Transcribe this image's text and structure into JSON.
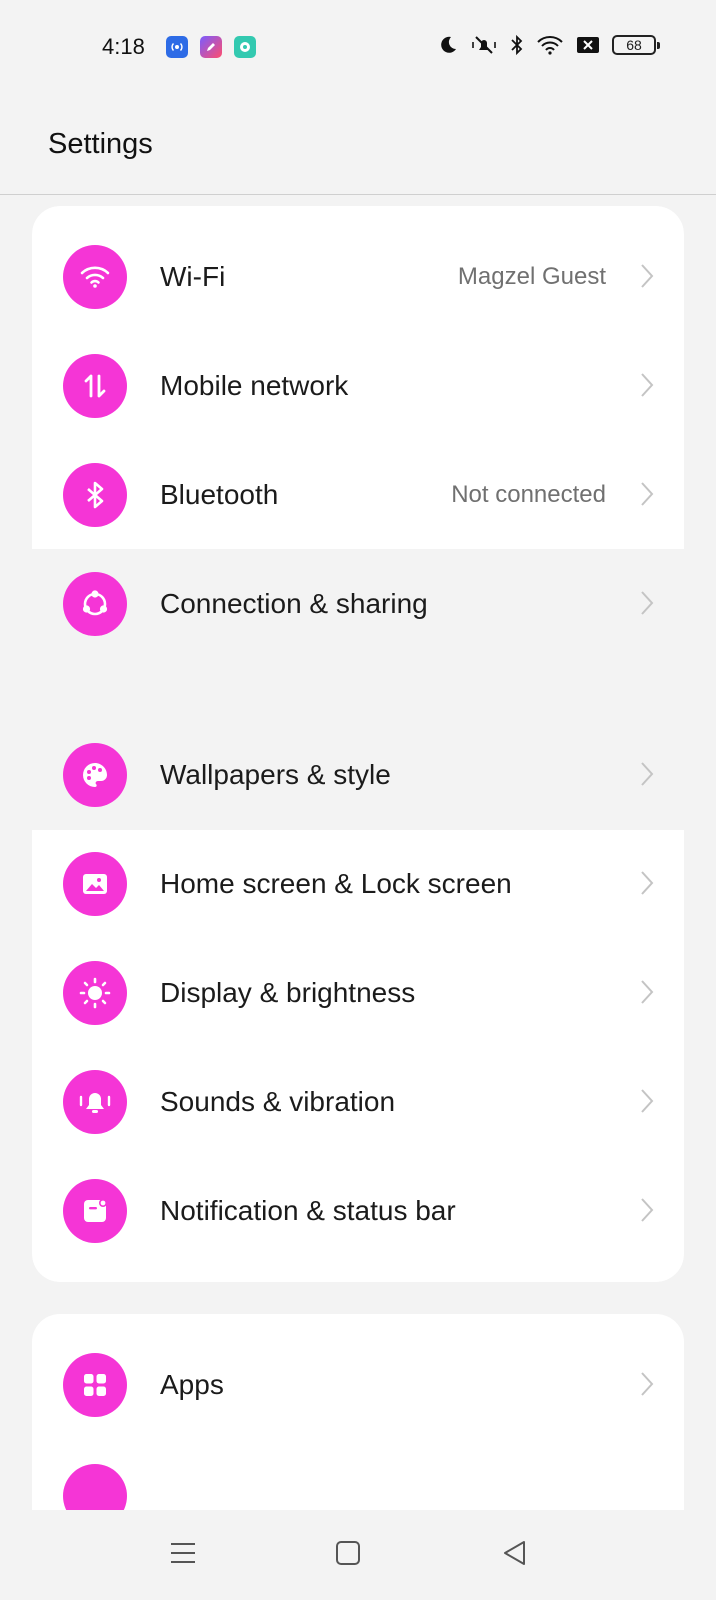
{
  "status_bar": {
    "time": "4:18",
    "battery": "68",
    "notification_icons": [
      "radio-app-icon",
      "pen-app-icon",
      "chat-app-icon"
    ],
    "system_icons": [
      "moon-icon",
      "mute-vibrate-icon",
      "bluetooth-icon",
      "wifi-icon",
      "no-sim-icon",
      "battery-icon"
    ]
  },
  "header": {
    "title": "Settings"
  },
  "groups": [
    {
      "items": [
        {
          "label": "Wi-Fi",
          "value": "Magzel Guest",
          "icon": "wifi-icon"
        },
        {
          "label": "Mobile network",
          "value": "",
          "icon": "mobile-data-icon"
        },
        {
          "label": "Bluetooth",
          "value": "Not connected",
          "icon": "bluetooth-icon"
        },
        {
          "label": "Connection & sharing",
          "value": "",
          "icon": "share-icon"
        }
      ]
    },
    {
      "items": [
        {
          "label": "Wallpapers & style",
          "value": "",
          "icon": "palette-icon"
        },
        {
          "label": "Home screen & Lock screen",
          "value": "",
          "icon": "image-icon"
        },
        {
          "label": "Display & brightness",
          "value": "",
          "icon": "brightness-icon"
        },
        {
          "label": "Sounds & vibration",
          "value": "",
          "icon": "bell-icon"
        },
        {
          "label": "Notification & status bar",
          "value": "",
          "icon": "notification-icon"
        }
      ]
    },
    {
      "items": [
        {
          "label": "Apps",
          "value": "",
          "icon": "apps-grid-icon"
        }
      ]
    }
  ],
  "colors": {
    "accent": "#f535d6",
    "background": "#f3f3f3",
    "card": "#ffffff",
    "secondary_text": "#707070"
  },
  "nav_bar": {
    "buttons": [
      "menu-icon",
      "home-icon",
      "back-icon"
    ]
  }
}
